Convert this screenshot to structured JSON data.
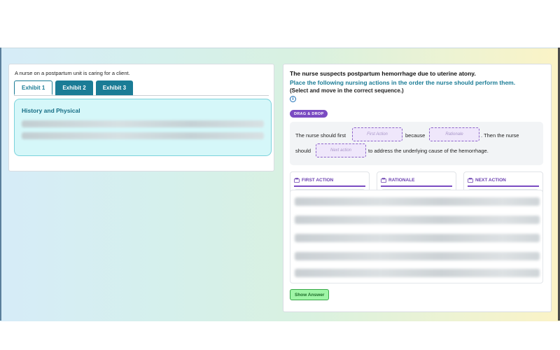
{
  "left": {
    "intro": "A nurse on a postpartum unit is caring for a client.",
    "tabs": [
      "Exhibit 1",
      "Exhibit 2",
      "Exhibit 3"
    ],
    "active_tab": 0,
    "history_title": "History and Physical"
  },
  "right": {
    "question_line1": "The nurse suspects postpartum hemorrhage due to uterine atony.",
    "question_line2": "Place the following nursing actions in the order the nurse should perform them.",
    "question_line3": "(Select and move in the correct sequence.)",
    "badge": "DRAG & DROP",
    "sentence": {
      "part1": "The nurse should first",
      "part2": "because",
      "part3": ". Then the nurse",
      "part4": "should",
      "part5": "to address the underlying cause of the hemorrhage.",
      "slot1": "First Action",
      "slot2": "Rationale",
      "slot3": "Next action"
    },
    "columns": [
      "FIRST ACTION",
      "RATIONALE",
      "NEXT ACTION"
    ],
    "show_answer": "Show Answer"
  },
  "colors": {
    "teal": "#1b7c96",
    "purple": "#7a4bc2",
    "green_button": "#9ff5a6"
  }
}
